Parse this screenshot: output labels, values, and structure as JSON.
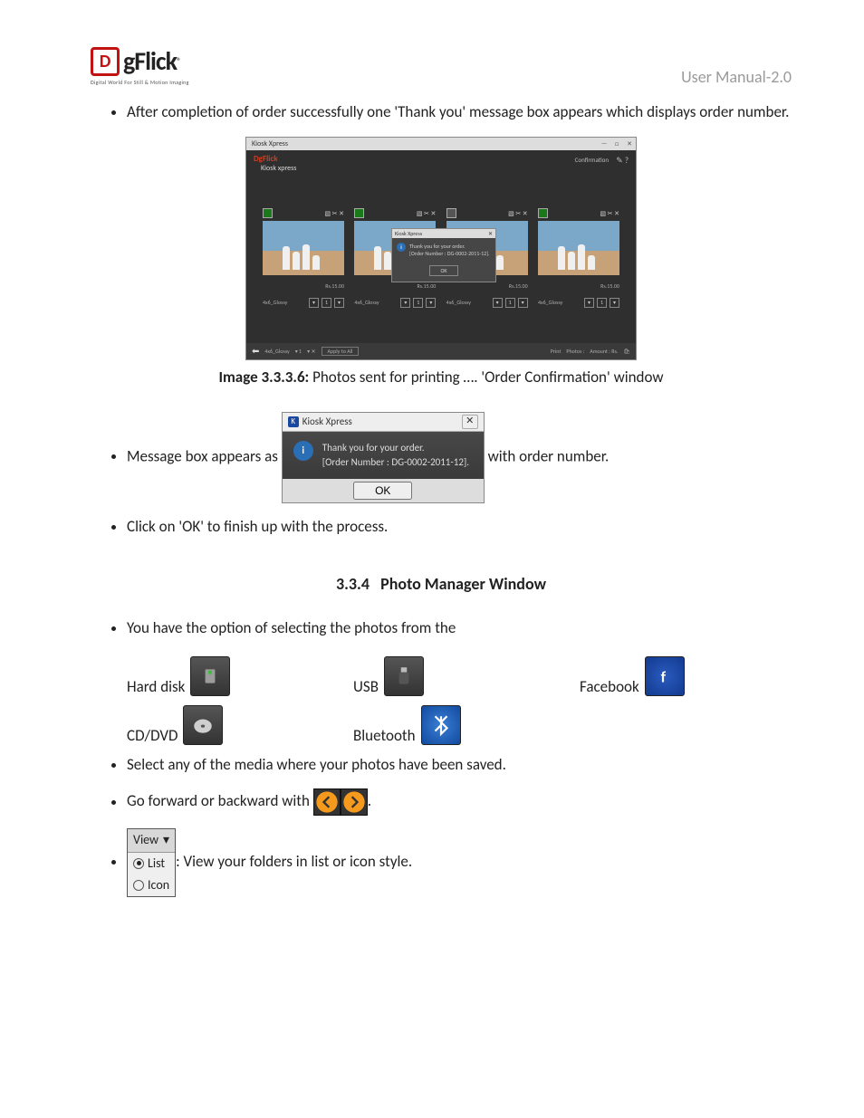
{
  "header": {
    "logo_letter": "D",
    "logo_text": "gFlick",
    "logo_reg": "®",
    "tagline": "Digital World For Still & Motion Imaging",
    "manual": "User Manual-2.0"
  },
  "p1": "After completion of order successfully one 'Thank you' message box appears which displays order number.",
  "screenshot": {
    "window_title": "Kiosk Xpress",
    "brand": "DgFlick",
    "sub_brand": "Kiosk xpress",
    "confirm_label": "Confirmation",
    "thumb_size": "4x6_Glossy",
    "thumb_price": "Rs.15.00",
    "qty": "1",
    "dialog_title": "Kiosk Xpress",
    "dialog_line1": "Thank you for your order.",
    "dialog_line2": "[Order Number : DG-0002-2011-12].",
    "dialog_ok": "OK",
    "footer_size": "4x6_Glossy",
    "footer_apply": "Apply to All",
    "footer_print": "Print",
    "footer_photos": "Photos :",
    "footer_amount": "Amount : Rs."
  },
  "caption_prefix": "Image 3.3.3.6:",
  "caption_text": " Photos sent for printing …. 'Order Confirmation' window",
  "p2_a": "Message box appears as ",
  "p2_b": " with order number.",
  "msgbox": {
    "title": "Kiosk Xpress",
    "line1": "Thank you for your order.",
    "line2": "[Order Number : DG-0002-2011-12].",
    "ok": "OK"
  },
  "p3": "Click on 'OK' to finish up with the process.",
  "section_num": "3.3.4",
  "section_title": "Photo Manager Window",
  "p4": "You have the option of selecting the photos from the",
  "media": {
    "hard_disk": "Hard disk",
    "usb": "USB",
    "facebook": "Facebook",
    "cddvd": "CD/DVD",
    "bluetooth": "Bluetooth"
  },
  "p5": "Select any of the media where your photos have been saved.",
  "p6_a": "Go forward or backward with ",
  "p6_b": ".",
  "view": {
    "header": "View",
    "list": "List",
    "icon": "Icon"
  },
  "p7": ": View your folders in list or icon style."
}
